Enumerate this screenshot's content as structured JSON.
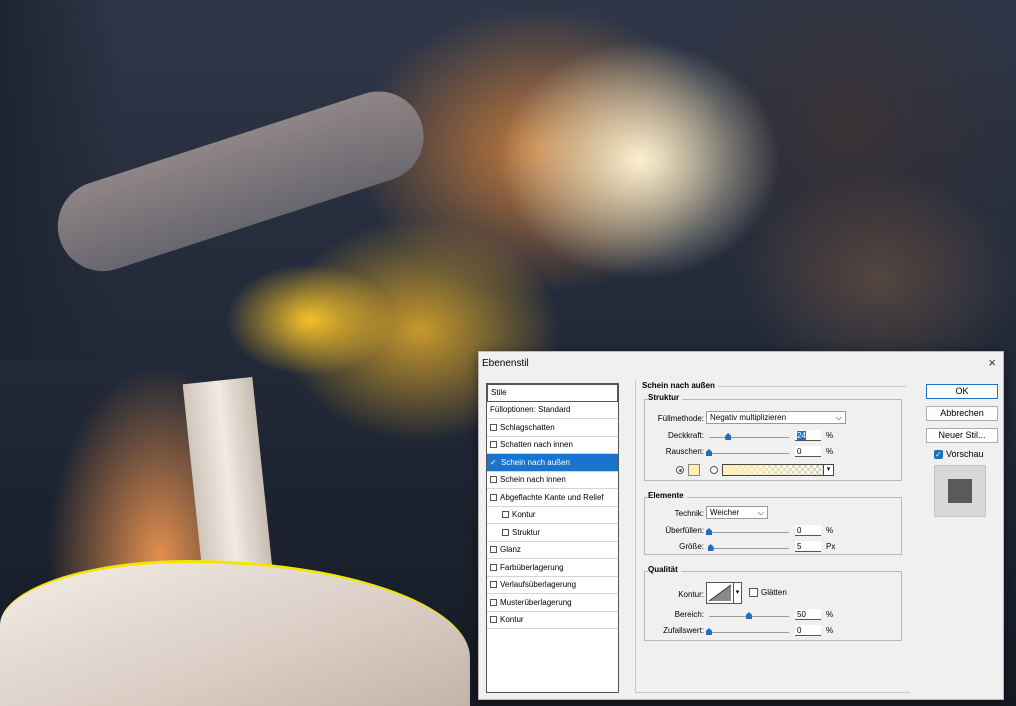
{
  "dialog": {
    "title": "Ebenenstil",
    "close_glyph": "×"
  },
  "styles_list": {
    "header": "Stile",
    "items": [
      {
        "label": "Fülloptionen: Standard",
        "checkbox": false
      },
      {
        "label": "Schlagschatten",
        "checkbox": true,
        "checked": false
      },
      {
        "label": "Schatten nach innen",
        "checkbox": true,
        "checked": false
      },
      {
        "label": "Schein nach außen",
        "checkbox": true,
        "checked": true,
        "selected": true
      },
      {
        "label": "Schein nach innen",
        "checkbox": true,
        "checked": false
      },
      {
        "label": "Abgeflachte Kante und Relief",
        "checkbox": true,
        "checked": false
      },
      {
        "label": "Kontur",
        "checkbox": true,
        "checked": false,
        "indent": true
      },
      {
        "label": "Struktur",
        "checkbox": true,
        "checked": false,
        "indent": true
      },
      {
        "label": "Glanz",
        "checkbox": true,
        "checked": false
      },
      {
        "label": "Farbüberlagerung",
        "checkbox": true,
        "checked": false
      },
      {
        "label": "Verlaufsüberlagerung",
        "checkbox": true,
        "checked": false
      },
      {
        "label": "Musterüberlagerung",
        "checkbox": true,
        "checked": false
      },
      {
        "label": "Kontur",
        "checkbox": true,
        "checked": false
      }
    ]
  },
  "outer_glow": {
    "title": "Schein nach außen",
    "structure": {
      "title": "Struktur",
      "blend_mode_label": "Füllmethode:",
      "blend_mode_value": "Negativ multiplizieren",
      "opacity_label": "Deckkraft:",
      "opacity_value": "24",
      "opacity_unit": "%",
      "opacity_fraction": 0.24,
      "noise_label": "Rauschen:",
      "noise_value": "0",
      "noise_unit": "%",
      "noise_fraction": 0,
      "glow_color": "#fdf2b4"
    },
    "elements": {
      "title": "Elemente",
      "technique_label": "Technik:",
      "technique_value": "Weicher",
      "spread_label": "Überfüllen:",
      "spread_value": "0",
      "spread_unit": "%",
      "spread_fraction": 0,
      "size_label": "Größe:",
      "size_value": "5",
      "size_unit": "Px",
      "size_fraction": 0.02
    },
    "quality": {
      "title": "Qualität",
      "contour_label": "Kontur:",
      "antialias_label": "Glätten",
      "range_label": "Bereich:",
      "range_value": "50",
      "range_unit": "%",
      "range_fraction": 0.5,
      "jitter_label": "Zufallswert:",
      "jitter_value": "0",
      "jitter_unit": "%",
      "jitter_fraction": 0
    }
  },
  "buttons": {
    "ok": "OK",
    "cancel": "Abbrechen",
    "new_style": "Neuer Stil...",
    "preview_label": "Vorschau",
    "preview_checked": true
  },
  "colors": {
    "accent": "#1874cf",
    "glow_color": "#fdf2b4",
    "contour_edge": "#f2e600"
  }
}
